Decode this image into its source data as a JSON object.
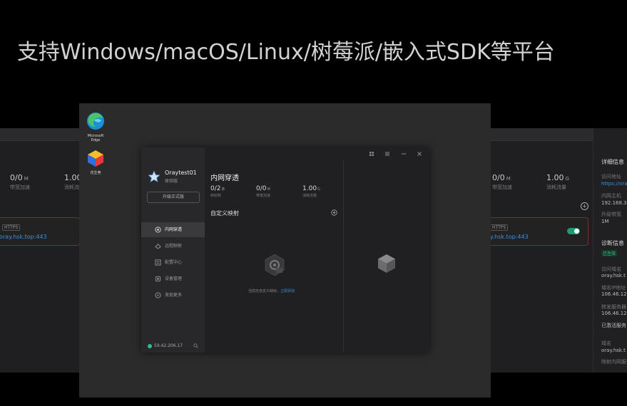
{
  "headline": "支持Windows/macOS/Linux/树莓派/嵌入式SDK等平台",
  "background_left": {
    "stats": [
      {
        "value": "0/0",
        "unit": "M",
        "label": "带宽加速"
      },
      {
        "value": "1.00",
        "unit": "",
        "label": "消耗流量"
      }
    ],
    "tunnel": {
      "tag": "HTTPS",
      "link": "oray.hsk.top:443"
    }
  },
  "background_right": {
    "stats": [
      {
        "value": "0/0",
        "unit": "M",
        "label": "带宽加速"
      },
      {
        "value": "1.00",
        "unit": "G",
        "label": "消耗流量"
      }
    ],
    "tunnel": {
      "tag": "HTTPS",
      "link": "y.hsk.top:443"
    },
    "detail": {
      "title": "详细信息",
      "access_label": "访问地址",
      "access_value": "https://ora",
      "host_label": "内网主机",
      "host_value": "192.168.3",
      "bandwidth_label": "升级带宽",
      "bandwidth_value": "1M",
      "diag_title": "诊断信息",
      "diag_badge": "已生效",
      "domain_label": "访问域名",
      "domain_value": "oray.hsk.t",
      "resolve_label": "域名IP地址",
      "resolve_value": "106.46.12",
      "forward_label": "转发服务器",
      "forward_value": "106.46.12",
      "status_value": "已激活服务",
      "domain2_label": "域名",
      "domain2_value": "oray.hsk.t",
      "service_value": "映射内网服务"
    }
  },
  "desktop_icons": [
    {
      "name": "Microsoft Edge",
      "label": "Microsoft Edge"
    },
    {
      "name": "app",
      "label": "花生壳"
    }
  ],
  "app": {
    "user": {
      "name": "Oraytest01",
      "tier": "体验版"
    },
    "upgrade_label": "升级正式版",
    "nav": [
      {
        "label": "内网穿透",
        "active": true
      },
      {
        "label": "远程映射",
        "active": false
      },
      {
        "label": "配置中心",
        "active": false
      },
      {
        "label": "设备管理",
        "active": false
      },
      {
        "label": "发现更多",
        "active": false
      }
    ],
    "ip": "59.42.206.17",
    "page_title": "内网穿透",
    "stats": [
      {
        "value": "0/2",
        "unit": "条",
        "label": "映射数"
      },
      {
        "value": "0/0",
        "unit": "M",
        "label": "带宽加速"
      },
      {
        "value": "1.00",
        "unit": "G",
        "label": "消耗流量"
      }
    ],
    "section_title": "自定义映射",
    "empty_text": "当前无自定义映射，",
    "empty_link": "立即添加"
  }
}
